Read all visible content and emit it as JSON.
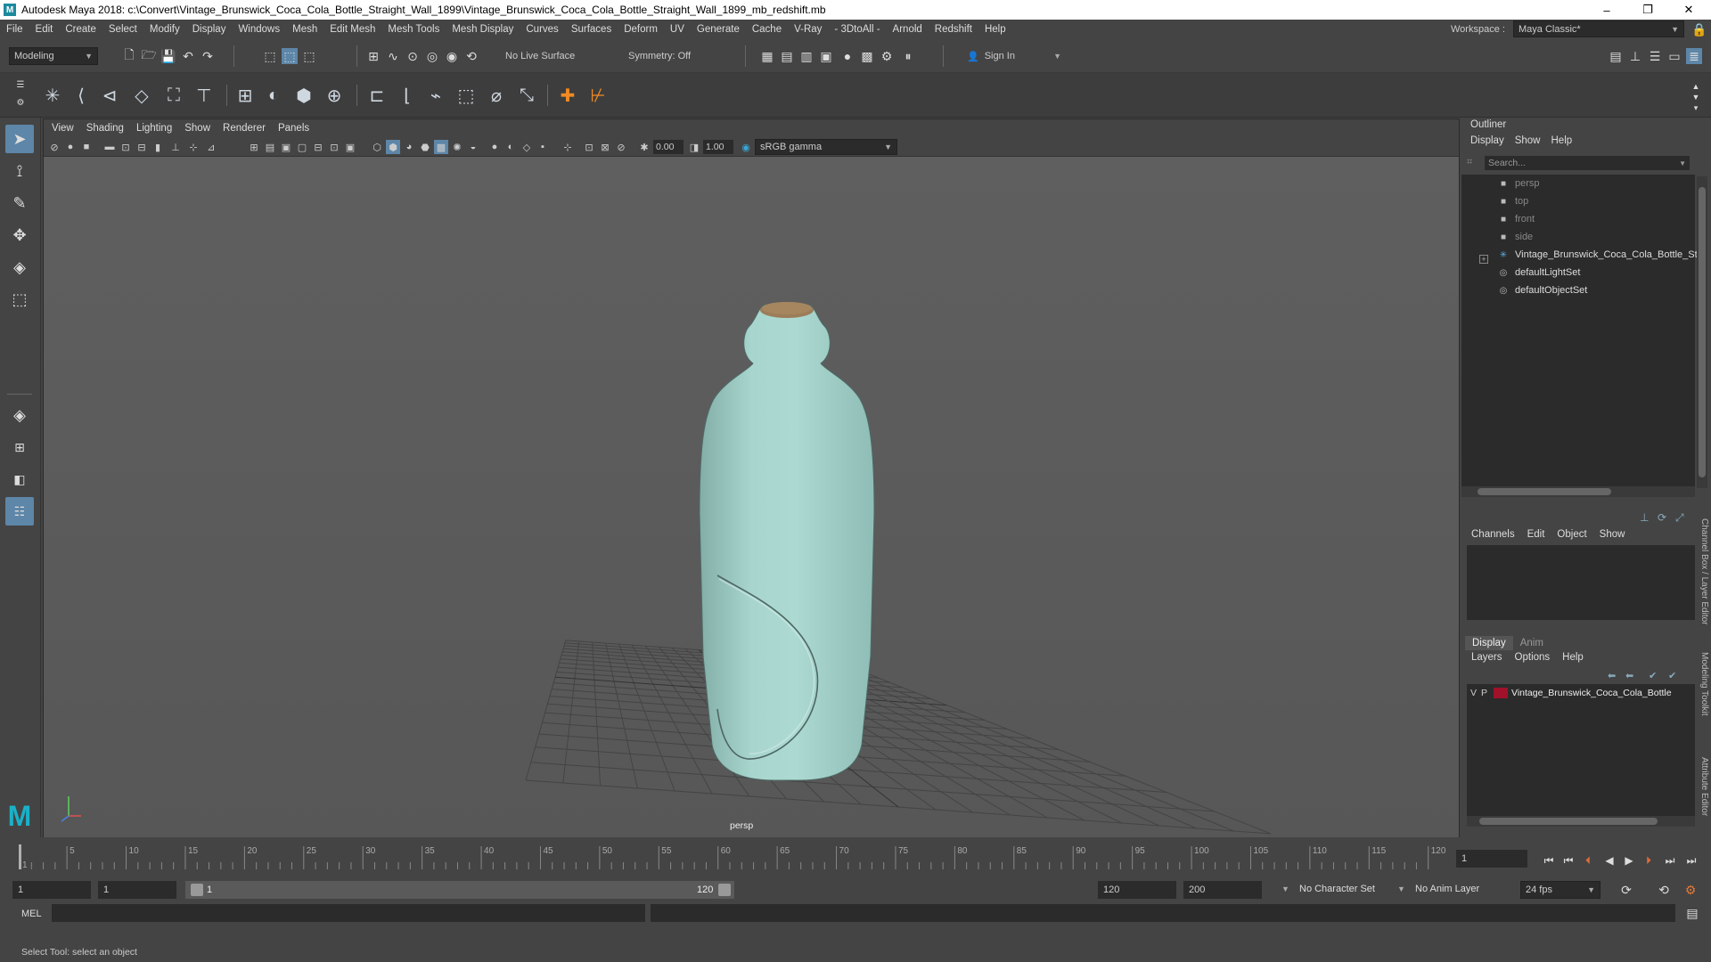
{
  "titlebar": {
    "title": "Autodesk Maya 2018: c:\\Convert\\Vintage_Brunswick_Coca_Cola_Bottle_Straight_Wall_1899\\Vintage_Brunswick_Coca_Cola_Bottle_Straight_Wall_1899_mb_redshift.mb",
    "minimize": "–",
    "maximize": "❐",
    "close": "✕"
  },
  "menubar": {
    "items": [
      "File",
      "Edit",
      "Create",
      "Select",
      "Modify",
      "Display",
      "Windows",
      "Mesh",
      "Edit Mesh",
      "Mesh Tools",
      "Mesh Display",
      "Curves",
      "Surfaces",
      "Deform",
      "UV",
      "Generate",
      "Cache",
      "V-Ray",
      "- 3DtoAll -",
      "Arnold",
      "Redshift",
      "Help"
    ],
    "workspace_label": "Workspace :",
    "workspace_value": "Maya Classic*"
  },
  "status_line": {
    "mode": "Modeling",
    "live_surface": "No Live Surface",
    "symmetry": "Symmetry: Off",
    "sign_in": "Sign In"
  },
  "viewport": {
    "menu": [
      "View",
      "Shading",
      "Lighting",
      "Show",
      "Renderer",
      "Panels"
    ],
    "exposure": "0.00",
    "gamma": "1.00",
    "color_space": "sRGB gamma",
    "camera_label": "persp"
  },
  "outliner": {
    "title": "Outliner",
    "menu": [
      "Display",
      "Show",
      "Help"
    ],
    "search_placeholder": "Search...",
    "items": [
      {
        "label": "persp",
        "icon": "camera-icon",
        "dim": true
      },
      {
        "label": "top",
        "icon": "camera-icon",
        "dim": true
      },
      {
        "label": "front",
        "icon": "camera-icon",
        "dim": true
      },
      {
        "label": "side",
        "icon": "camera-icon",
        "dim": true
      },
      {
        "label": "Vintage_Brunswick_Coca_Cola_Bottle_St",
        "icon": "group-icon",
        "dim": false
      },
      {
        "label": "defaultLightSet",
        "icon": "set-icon",
        "dim": false
      },
      {
        "label": "defaultObjectSet",
        "icon": "set-icon",
        "dim": false
      }
    ]
  },
  "channel_box": {
    "menu": [
      "Channels",
      "Edit",
      "Object",
      "Show"
    ]
  },
  "layer_editor": {
    "tabs": [
      "Display",
      "Anim"
    ],
    "menu": [
      "Layers",
      "Options",
      "Help"
    ],
    "layer": {
      "v": "V",
      "p": "P",
      "name": "Vintage_Brunswick_Coca_Cola_Bottle",
      "color": "#a0122a"
    }
  },
  "side_tabs": [
    "Channel Box / Layer Editor",
    "Modeling Toolkit",
    "Attribute Editor"
  ],
  "timeline": {
    "ticks": [
      "1",
      "5",
      "10",
      "15",
      "20",
      "25",
      "30",
      "35",
      "40",
      "45",
      "50",
      "55",
      "60",
      "65",
      "70",
      "75",
      "80",
      "85",
      "90",
      "95",
      "100",
      "105",
      "110",
      "115",
      "120"
    ],
    "current_frame": "1"
  },
  "range": {
    "start": "1",
    "playback_start": "1",
    "slider_start": "1",
    "slider_end": "120",
    "playback_end": "120",
    "end": "200",
    "character_set": "No Character Set",
    "anim_layer": "No Anim Layer",
    "fps": "24 fps"
  },
  "mel": {
    "label": "MEL"
  },
  "help_line": "Select Tool: select an object",
  "colors": {
    "bottle": "#a5d4cc",
    "cork": "#9c7d5a",
    "selection": "#5d86a8"
  }
}
